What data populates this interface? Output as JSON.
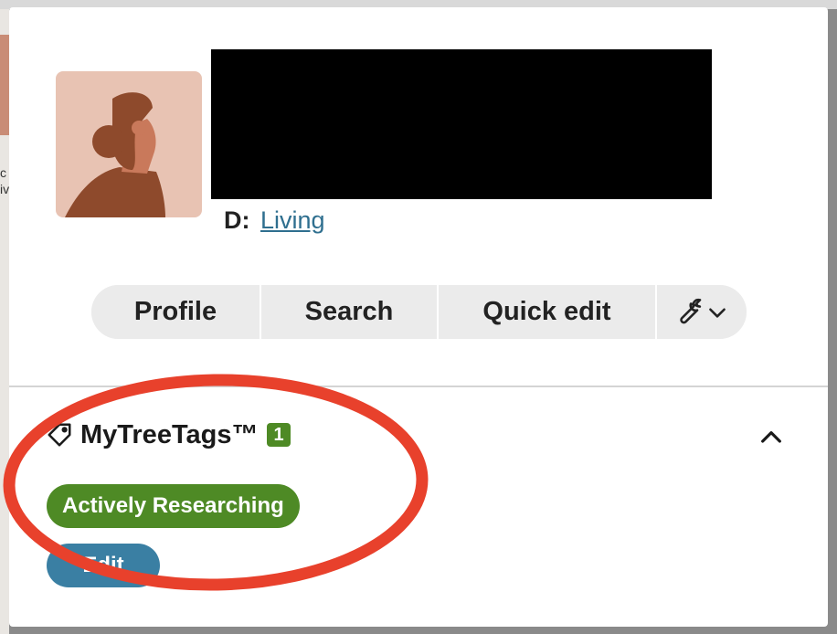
{
  "background": {
    "partial_text": "c\niv"
  },
  "person": {
    "death_label": "D:",
    "death_value": "Living"
  },
  "actions": {
    "profile": "Profile",
    "search": "Search",
    "quick_edit": "Quick edit",
    "tools_icon": "wrench-icon",
    "tools_chevron": "chevron-down-icon"
  },
  "tags": {
    "title": "MyTreeTags™",
    "count": "1",
    "items": [
      {
        "label": "Actively Researching",
        "color": "#4e8a25"
      }
    ],
    "edit_label": "Edit",
    "collapse_icon": "chevron-up-icon"
  },
  "colors": {
    "link": "#2f6f8f",
    "tag_green": "#4e8a25",
    "edit_blue": "#3a7fa3",
    "annotation_red": "#e8412c",
    "button_bg": "#ebebeb"
  }
}
